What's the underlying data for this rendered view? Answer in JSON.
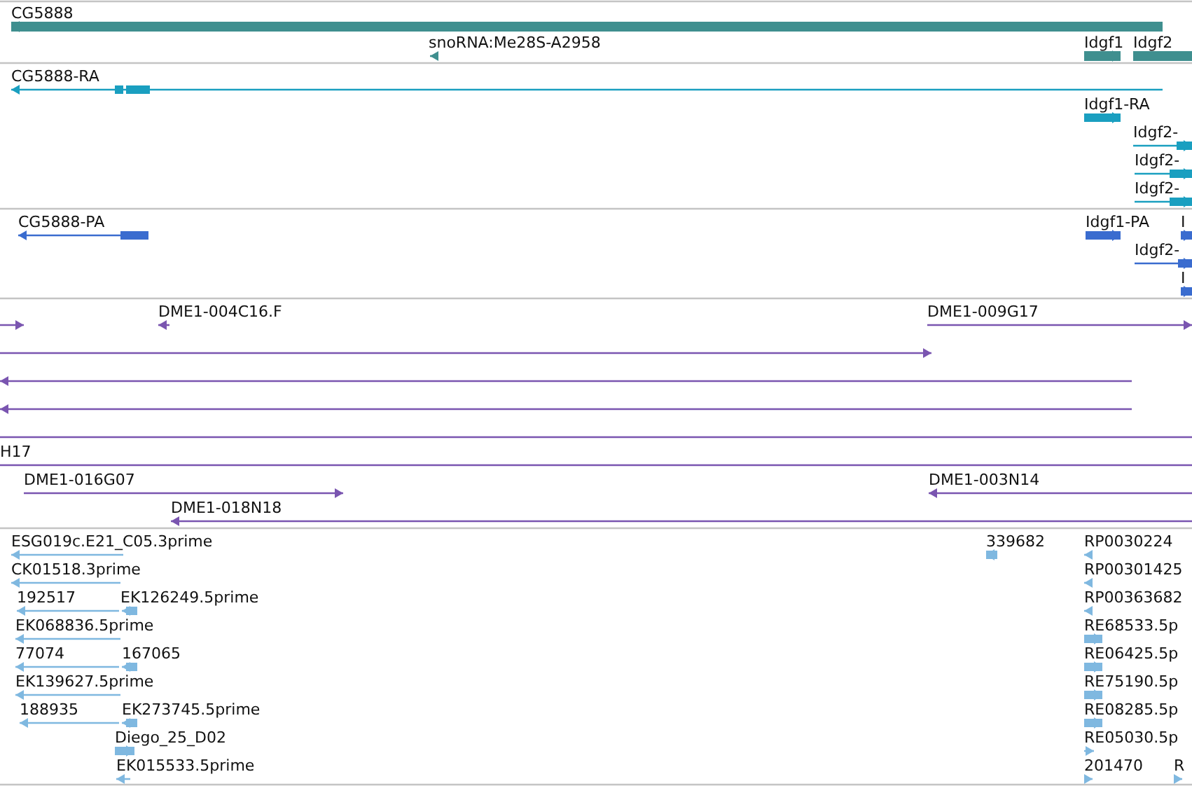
{
  "tracks": [
    {
      "color": "#3f8f8f",
      "features": [
        {
          "label": "CG5888",
          "kind": "arrow",
          "reverse": true
        },
        {
          "label": "snoRNA:Me28S-A2958",
          "kind": "arrow",
          "reverse": true
        },
        {
          "label": "Idgf1",
          "kind": "arrow",
          "reverse": false
        },
        {
          "label": "Idgf2",
          "kind": "line"
        }
      ]
    },
    {
      "color": "#1a9fc0",
      "features": [
        {
          "label": "CG5888-RA",
          "kind": "arrow",
          "reverse": true
        },
        {
          "label": "Idgf1-RA",
          "kind": "arrow",
          "reverse": false
        },
        {
          "label": "Idgf2-",
          "kind": "arrow",
          "reverse": false
        },
        {
          "label": "Idgf2-",
          "kind": "arrow",
          "reverse": false
        },
        {
          "label": "Idgf2-",
          "kind": "arrow",
          "reverse": false
        }
      ]
    },
    {
      "color": "#3a6ccf",
      "features": [
        {
          "label": "CG5888-PA",
          "kind": "arrow",
          "reverse": true
        },
        {
          "label": "Idgf1-PA",
          "kind": "arrow",
          "reverse": false
        },
        {
          "label": "I",
          "kind": "arrow",
          "reverse": false
        },
        {
          "label": "Idgf2-",
          "kind": "arrow",
          "reverse": false
        },
        {
          "label": "I",
          "kind": "arrow",
          "reverse": false
        }
      ]
    },
    {
      "color": "#7a55b0",
      "features": [
        {
          "kind": "arrow",
          "reverse": false
        },
        {
          "label": "DME1-004C16.F",
          "kind": "arrow",
          "reverse": true
        },
        {
          "label": "DME1-009G17",
          "kind": "arrow",
          "reverse": false
        },
        {
          "kind": "arrow",
          "reverse": false
        },
        {
          "kind": "arrow",
          "reverse": true
        },
        {
          "kind": "arrow",
          "reverse": true
        },
        {
          "kind": "line"
        },
        {
          "label": "H17",
          "kind": "line"
        },
        {
          "label": "DME1-016G07",
          "kind": "arrow",
          "reverse": false
        },
        {
          "label": "DME1-003N14",
          "kind": "arrow",
          "reverse": true
        },
        {
          "label": "DME1-018N18",
          "kind": "arrow",
          "reverse": true
        }
      ]
    },
    {
      "color": "#7fb8e0",
      "features": [
        {
          "label": "ESG019c.E21_C05.3prime",
          "kind": "arrow",
          "reverse": true
        },
        {
          "label": "339682",
          "kind": "arrow",
          "reverse": true
        },
        {
          "label": "RP0030224",
          "kind": "arrow",
          "reverse": true
        },
        {
          "label": "CK01518.3prime",
          "kind": "arrow",
          "reverse": true
        },
        {
          "label": "RP00301425",
          "kind": "arrow",
          "reverse": true
        },
        {
          "label": "192517",
          "kind": "arrow",
          "reverse": true
        },
        {
          "label": "EK126249.5prime",
          "kind": "arrow",
          "reverse": true
        },
        {
          "label": "RP00363682",
          "kind": "arrow",
          "reverse": true
        },
        {
          "label": "EK068836.5prime",
          "kind": "arrow",
          "reverse": true
        },
        {
          "label": "RE68533.5p",
          "kind": "arrow",
          "reverse": false
        },
        {
          "label": "77074",
          "kind": "arrow",
          "reverse": true
        },
        {
          "label": "167065",
          "kind": "arrow",
          "reverse": true
        },
        {
          "label": "RE06425.5p",
          "kind": "arrow",
          "reverse": false
        },
        {
          "label": "EK139627.5prime",
          "kind": "arrow",
          "reverse": true
        },
        {
          "label": "RE75190.5p",
          "kind": "arrow",
          "reverse": false
        },
        {
          "label": "188935",
          "kind": "arrow",
          "reverse": true
        },
        {
          "label": "EK273745.5prime",
          "kind": "arrow",
          "reverse": true
        },
        {
          "label": "RE08285.5p",
          "kind": "arrow",
          "reverse": false
        },
        {
          "label": "Diego_25_D02",
          "kind": "arrow",
          "reverse": false
        },
        {
          "label": "RE05030.5p",
          "kind": "arrow",
          "reverse": false
        },
        {
          "label": "EK015533.5prime",
          "kind": "arrow",
          "reverse": true
        },
        {
          "label": "201470",
          "kind": "arrow",
          "reverse": false
        },
        {
          "label": "R",
          "kind": "arrow",
          "reverse": false
        }
      ]
    }
  ]
}
